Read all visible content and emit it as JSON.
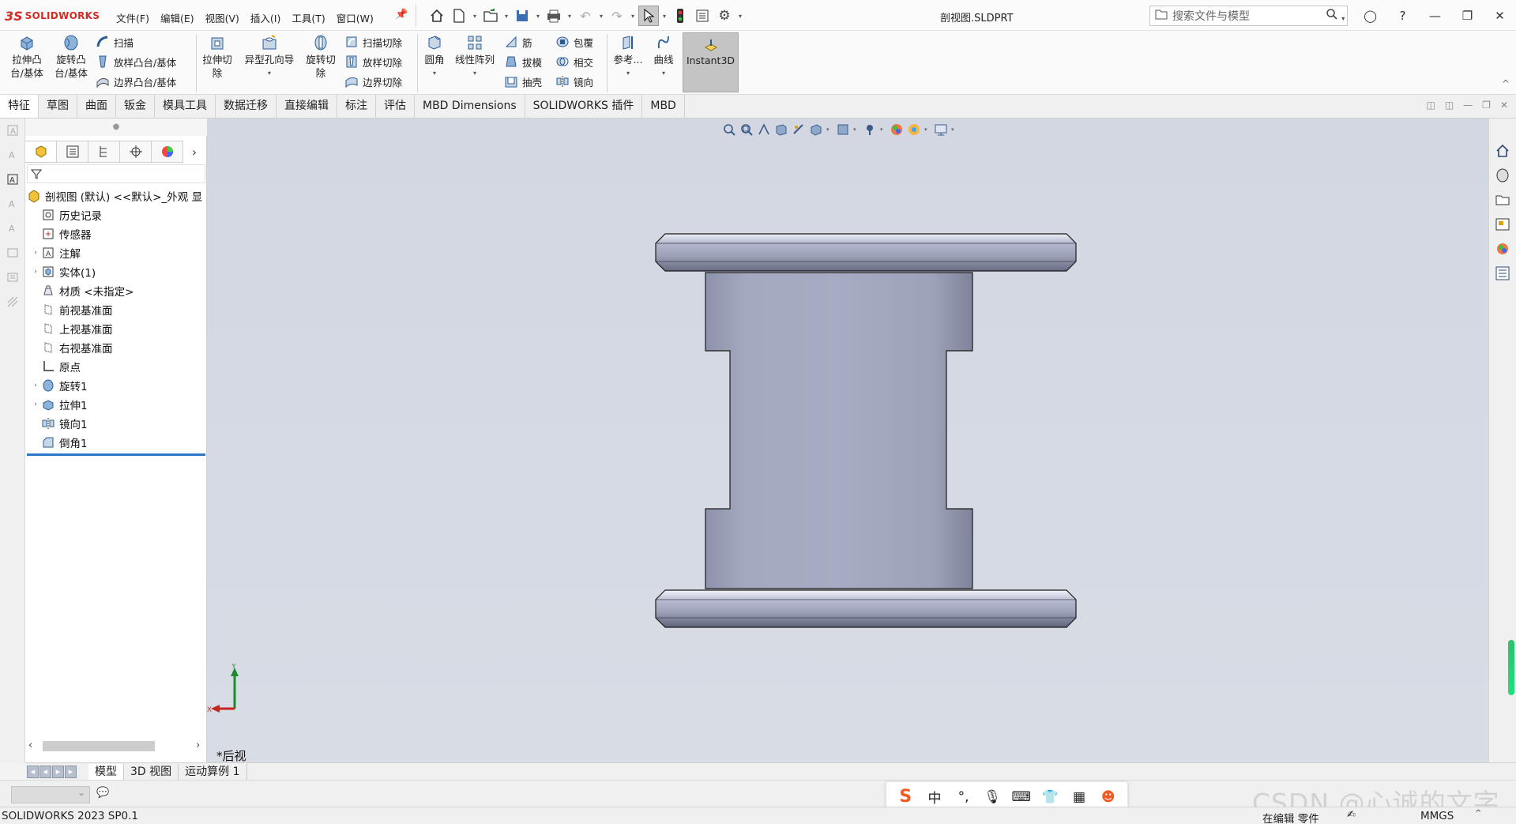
{
  "app": {
    "logo_text": "SOLIDWORKS",
    "document_title": "剖视图.SLDPRT",
    "search_placeholder": "搜索文件与模型"
  },
  "menus": [
    "文件(F)",
    "编辑(E)",
    "视图(V)",
    "插入(I)",
    "工具(T)",
    "窗口(W)"
  ],
  "ribbon": {
    "extrude_boss": "拉伸凸\n台/基体",
    "revolve_boss": "旋转凸\n台/基体",
    "sweep": "扫描",
    "loft": "放样凸台/基体",
    "boundary": "边界凸台/基体",
    "extrude_cut": "拉伸切\n除",
    "hole_wizard": "异型孔向导",
    "revolve_cut": "旋转切\n除",
    "swept_cut": "扫描切除",
    "lofted_cut": "放样切除",
    "boundary_cut": "边界切除",
    "fillet": "圆角",
    "linear_pattern": "线性阵列",
    "rib": "筋",
    "draft": "拔模",
    "shell": "抽壳",
    "wrap": "包覆",
    "intersect": "相交",
    "mirror": "镜向",
    "reference": "参考...",
    "curves": "曲线",
    "instant3d": "Instant3D"
  },
  "command_tabs": [
    "特征",
    "草图",
    "曲面",
    "钣金",
    "模具工具",
    "数据迁移",
    "直接编辑",
    "标注",
    "评估",
    "MBD Dimensions",
    "SOLIDWORKS 插件",
    "MBD"
  ],
  "feature_tree": {
    "root": "剖视图 (默认) <<默认>_外观 显",
    "items": [
      {
        "label": "历史记录",
        "expandable": false,
        "icon": "history-icon"
      },
      {
        "label": "传感器",
        "expandable": false,
        "icon": "sensor-icon"
      },
      {
        "label": "注解",
        "expandable": true,
        "icon": "annotation-icon"
      },
      {
        "label": "实体(1)",
        "expandable": true,
        "icon": "solid-bodies-icon"
      },
      {
        "label": "材质 <未指定>",
        "expandable": false,
        "icon": "material-icon"
      },
      {
        "label": "前视基准面",
        "expandable": false,
        "icon": "plane-icon"
      },
      {
        "label": "上视基准面",
        "expandable": false,
        "icon": "plane-icon"
      },
      {
        "label": "右视基准面",
        "expandable": false,
        "icon": "plane-icon"
      },
      {
        "label": "原点",
        "expandable": false,
        "icon": "origin-icon"
      },
      {
        "label": "旋转1",
        "expandable": true,
        "icon": "revolve-icon"
      },
      {
        "label": "拉伸1",
        "expandable": true,
        "icon": "extrude-icon"
      },
      {
        "label": "镜向1",
        "expandable": false,
        "icon": "mirror-icon"
      },
      {
        "label": "倒角1",
        "expandable": false,
        "icon": "chamfer-icon"
      }
    ]
  },
  "viewport": {
    "view_name": "*后视",
    "triad_x": "X",
    "triad_y": "Y"
  },
  "model_tabs": [
    "模型",
    "3D 视图",
    "运动算例 1"
  ],
  "ime": {
    "cn": "中",
    "punct": "°,"
  },
  "watermark": "CSDN @心诚的文字",
  "status": {
    "app_version": "SOLIDWORKS 2023 SP0.1",
    "mode": "在编辑 零件",
    "units": "MMGS",
    "caret": "^"
  },
  "colors": {
    "brand_red": "#d42b24",
    "viewport_bg": "#d4d9e3",
    "rollback_bar": "#2a77c8",
    "selected_tool": "#c4c4c4"
  }
}
